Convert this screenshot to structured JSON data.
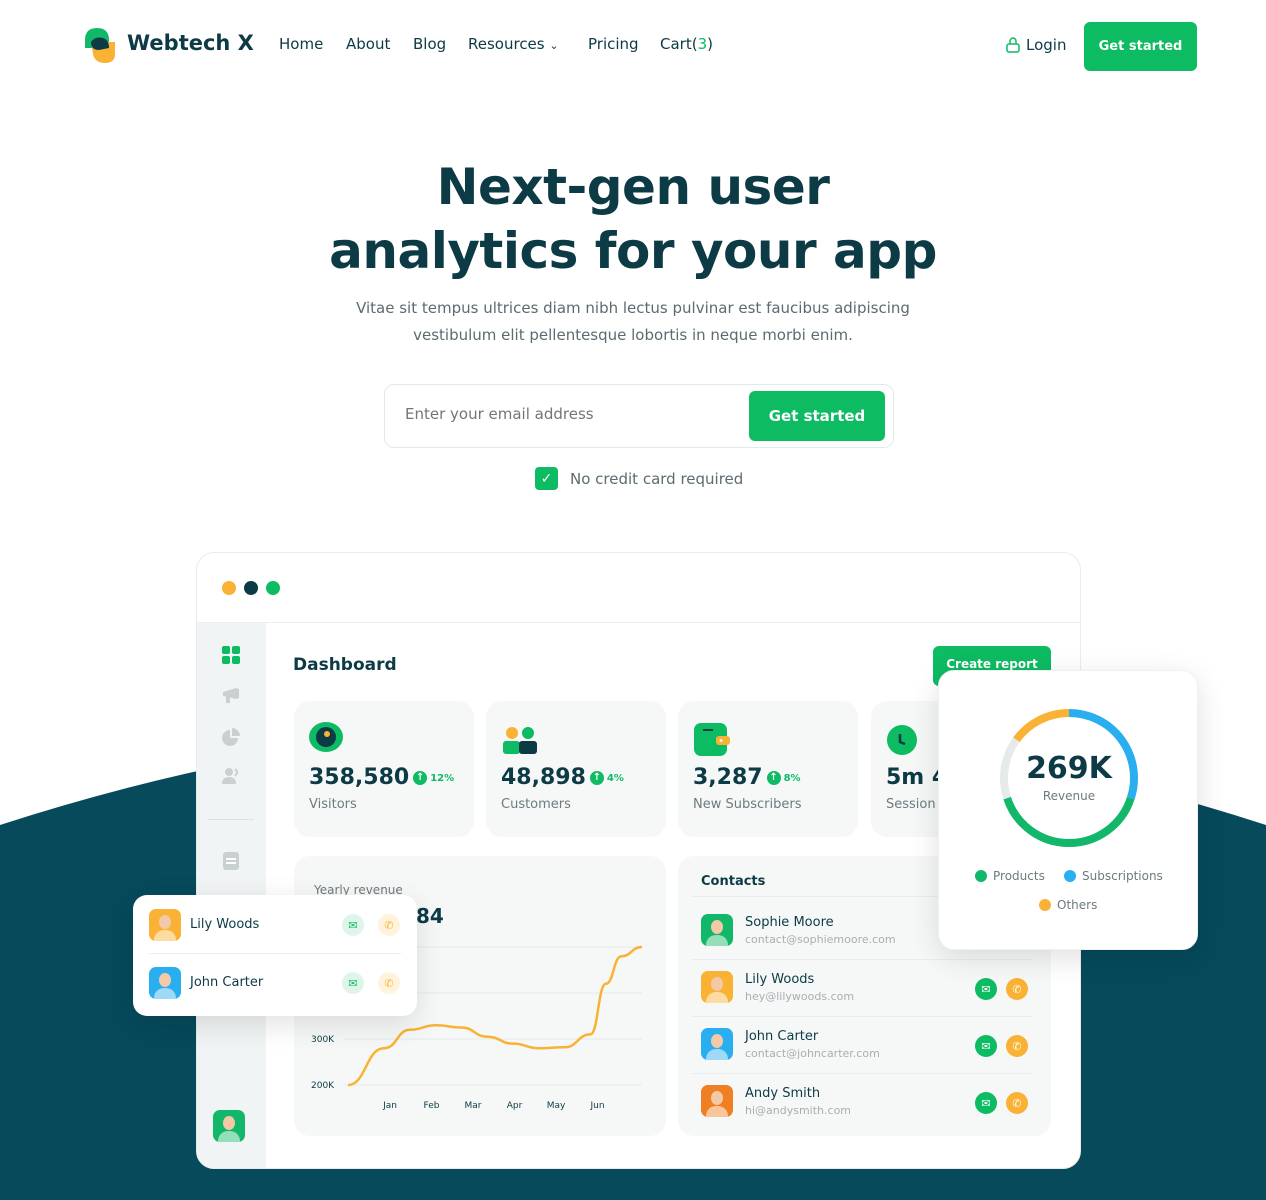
{
  "brand": {
    "name": "Webtech X"
  },
  "nav": {
    "items": [
      {
        "label": "Home"
      },
      {
        "label": "About"
      },
      {
        "label": "Blog"
      },
      {
        "label": "Resources"
      },
      {
        "label": "Pricing"
      },
      {
        "label": "Cart(",
        "count": "3",
        "suffix": ")"
      }
    ],
    "login": "Login",
    "cta": "Get started"
  },
  "hero": {
    "title_line1": "Next-gen user",
    "title_line2": "analytics for your app",
    "subtitle_line1": "Vitae sit tempus ultrices diam nibh lectus pulvinar est faucibus adipiscing",
    "subtitle_line2": "vestibulum elit pellentesque lobortis in neque morbi enim.",
    "email_placeholder": "Enter your email address",
    "cta": "Get started",
    "checkbox_label": "No credit card required",
    "checkbox_checked": true
  },
  "dashboard": {
    "title": "Dashboard",
    "create_report": "Create report",
    "stats": [
      {
        "value": "358,580",
        "change": "12%",
        "label": "Visitors",
        "icon": "eye-icon"
      },
      {
        "value": "48,898",
        "change": "4%",
        "label": "Customers",
        "icon": "users-icon"
      },
      {
        "value": "3,287",
        "change": "8%",
        "label": "New Subscribers",
        "icon": "wallet-icon"
      },
      {
        "value": "5m 4",
        "label": "Session",
        "icon": "clock-icon"
      }
    ],
    "revenue_card": {
      "label": "Yearly revenue",
      "value_fragment": "84"
    },
    "contacts": {
      "title": "Contacts",
      "items": [
        {
          "name": "Sophie Moore",
          "email": "contact@sophiemoore.com",
          "color": "#12b76a"
        },
        {
          "name": "Lily Woods",
          "email": "hey@lilywoods.com",
          "color": "#f9b233"
        },
        {
          "name": "John Carter",
          "email": "contact@johncarter.com",
          "color": "#29aef0"
        },
        {
          "name": "Andy Smith",
          "email": "hi@andysmith.com",
          "color": "#f07f24"
        }
      ]
    },
    "floating_contacts": [
      {
        "name": "Lily Woods",
        "color": "#f9b233"
      },
      {
        "name": "John Carter",
        "color": "#29aef0"
      }
    ],
    "donut": {
      "value": "269K",
      "label": "Revenue"
    }
  },
  "colors": {
    "green": "#0dbb62",
    "dark": "#0c3a45",
    "band": "#064a5b",
    "orange": "#f9b233",
    "blue": "#29aef0"
  },
  "chart_data": [
    {
      "type": "line",
      "title": "Yearly revenue",
      "categories": [
        "Jan",
        "Feb",
        "Mar",
        "Apr",
        "May",
        "Jun"
      ],
      "y_ticks": [
        "200K",
        "300K"
      ],
      "ylim": [
        200000,
        500000
      ],
      "x": [
        0.3,
        1,
        1.5,
        2,
        2.5,
        3,
        3.5,
        4,
        4.5,
        5,
        5.3,
        5.6,
        6
      ],
      "values": [
        200000,
        280000,
        320000,
        330000,
        325000,
        305000,
        290000,
        280000,
        282000,
        310000,
        420000,
        480000,
        500000
      ],
      "grid": true,
      "color": "#f9b233"
    },
    {
      "type": "pie",
      "title": "269K",
      "subtitle": "Revenue",
      "legend": [
        "Products",
        "Subscriptions",
        "Others"
      ],
      "legend_placement": "bottom",
      "slices": [
        {
          "name": "Others",
          "value": 15,
          "color": "#f9b233"
        },
        {
          "name": "Subscriptions",
          "value": 30,
          "color": "#29aef0"
        },
        {
          "name": "Products",
          "value": 40,
          "color": "#12b76a"
        },
        {
          "name": "",
          "value": 15,
          "color": "#e6eaeb"
        }
      ]
    }
  ]
}
